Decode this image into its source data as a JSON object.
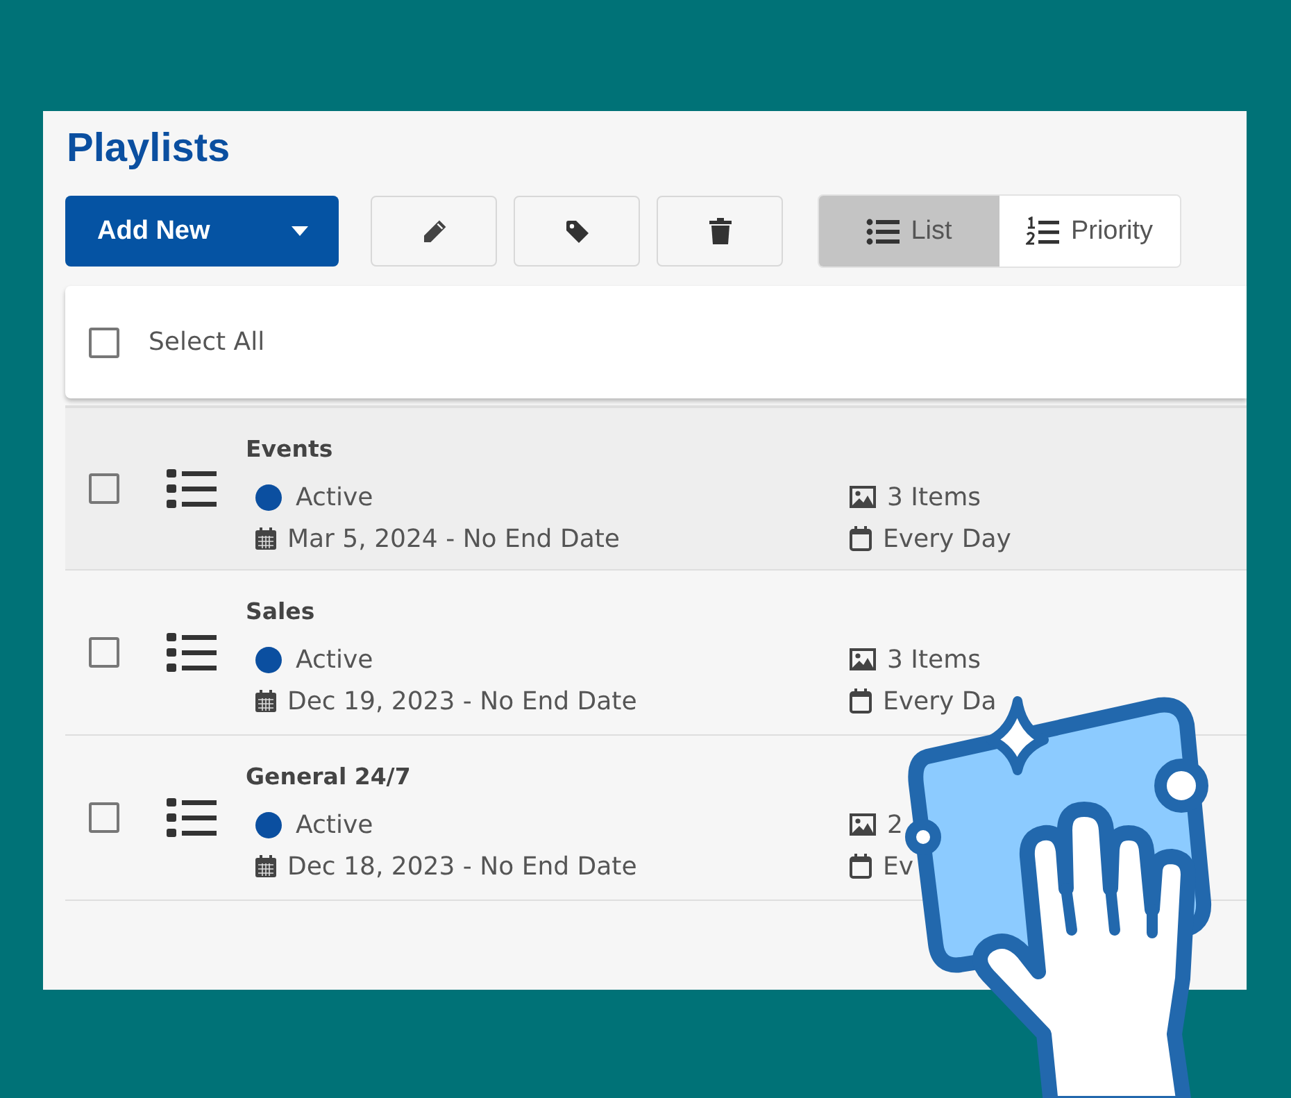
{
  "title": "Playlists",
  "toolbar": {
    "add_button": "Add New",
    "view_options": [
      {
        "label": "List",
        "kind": "list",
        "selected": true
      },
      {
        "label": "Priority",
        "kind": "priority",
        "selected": false
      }
    ]
  },
  "select_all": {
    "label": "Select All",
    "checked": false
  },
  "playlists": [
    {
      "name": "Events",
      "status": "Active",
      "color": "#0b4fa0",
      "dates": "Mar 5, 2024 - No End Date",
      "items": "3 Items",
      "schedule": "Every Day",
      "checked": false,
      "highlighted": true
    },
    {
      "name": "Sales",
      "status": "Active",
      "color": "#0b4fa0",
      "dates": "Dec 19, 2023 - No End Date",
      "items": "3 Items",
      "schedule": "Every Da",
      "checked": false,
      "highlighted": false
    },
    {
      "name": "General 24/7",
      "status": "Active",
      "color": "#0b4fa0",
      "dates": "Dec 18, 2023 - No End Date",
      "items": "2",
      "schedule": "Ev",
      "checked": false,
      "highlighted": false
    }
  ]
}
